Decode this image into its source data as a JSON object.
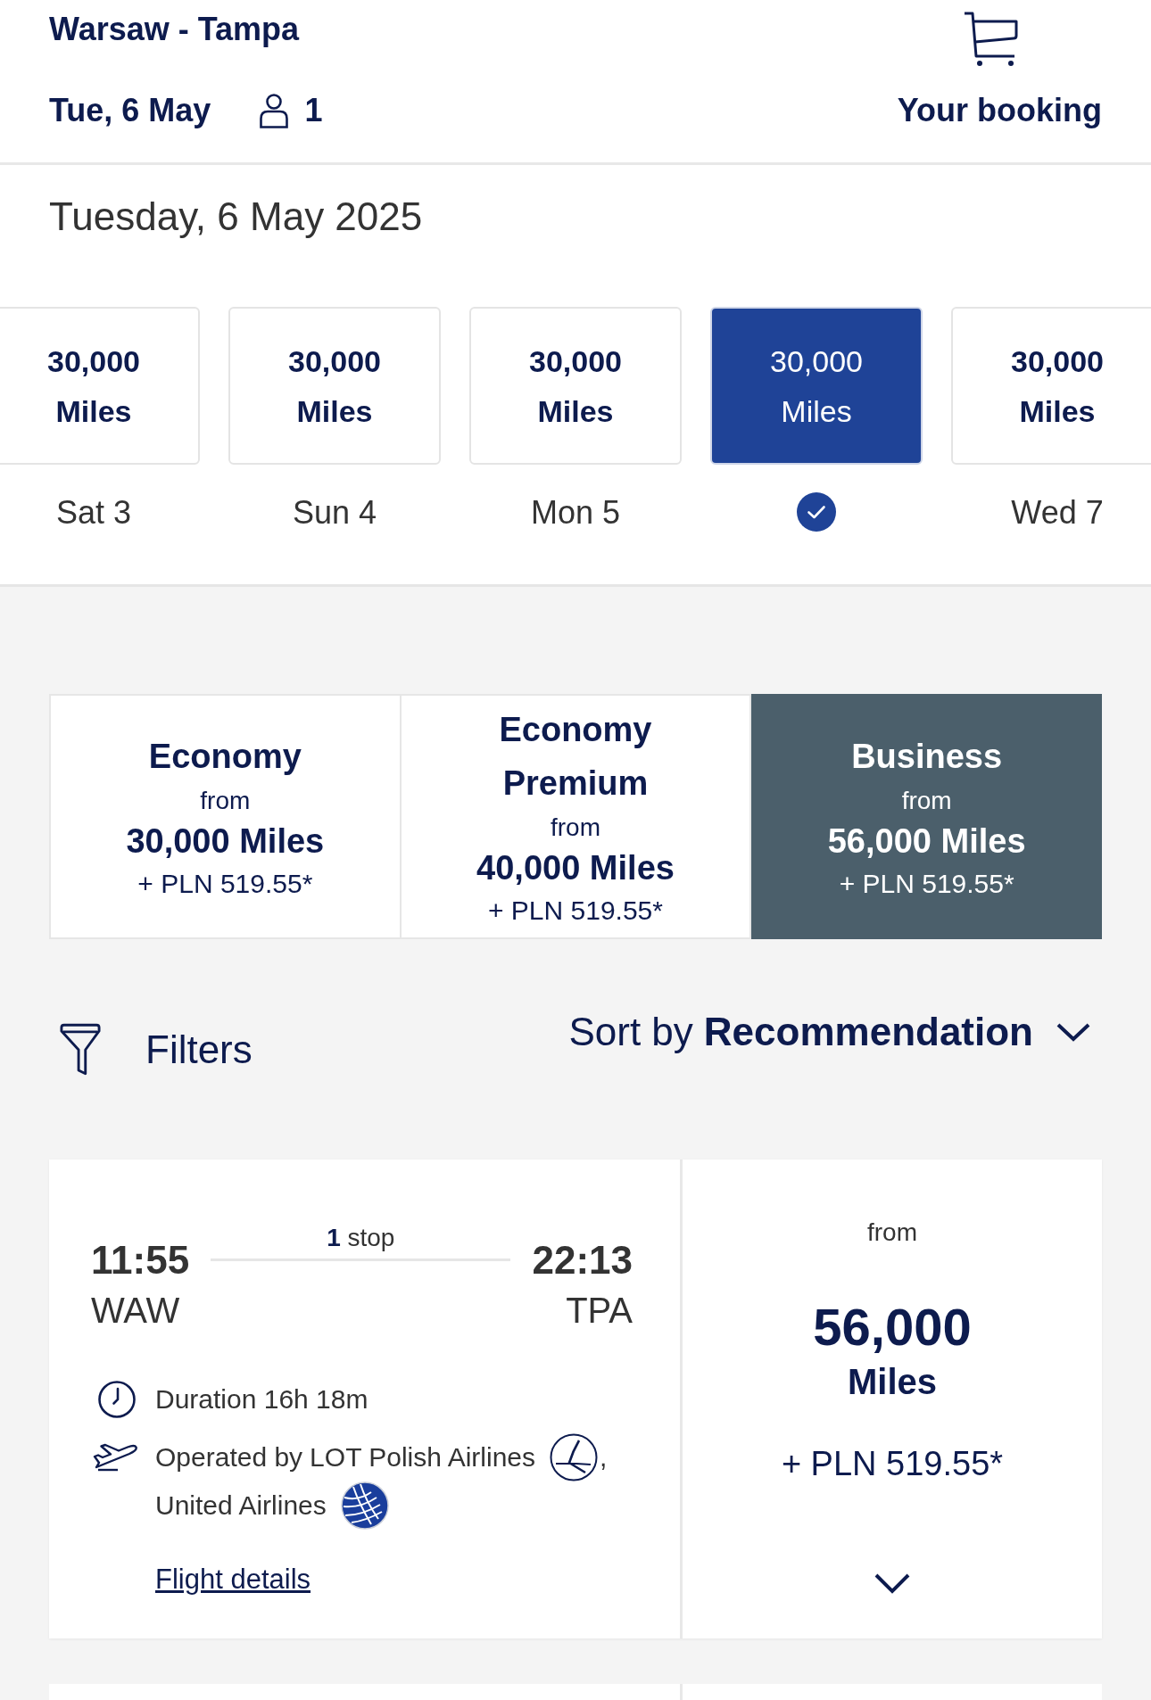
{
  "header": {
    "route": "Warsaw - Tampa",
    "date": "Tue, 6 May",
    "passengers": "1",
    "booking_label": "Your booking"
  },
  "date_bar": {
    "title": "Tuesday, 6 May 2025",
    "dates": [
      {
        "miles": "30,000",
        "unit": "Miles",
        "day": "Sat 3",
        "selected": false
      },
      {
        "miles": "30,000",
        "unit": "Miles",
        "day": "Sun 4",
        "selected": false
      },
      {
        "miles": "30,000",
        "unit": "Miles",
        "day": "Mon 5",
        "selected": false
      },
      {
        "miles": "30,000",
        "unit": "Miles",
        "selected": true
      },
      {
        "miles": "30,000",
        "unit": "Miles",
        "day": "Wed 7",
        "selected": false
      }
    ]
  },
  "cabins": [
    {
      "name": "Economy",
      "from": "from",
      "miles": "30,000 Miles",
      "price": "+ PLN 519.55*",
      "selected": false
    },
    {
      "name": "Economy Premium",
      "from": "from",
      "miles": "40,000 Miles",
      "price": "+ PLN 519.55*",
      "selected": false
    },
    {
      "name": "Business",
      "from": "from",
      "miles": "56,000 Miles",
      "price": "+ PLN 519.55*",
      "selected": true
    }
  ],
  "toolbar": {
    "filters": "Filters",
    "sort_label": "Sort by",
    "sort_value": "Recommendation"
  },
  "flights": [
    {
      "departure": {
        "time": "11:55",
        "airport": "WAW"
      },
      "stops": "**1** stop",
      "arrival": {
        "time": "22:13",
        "airport": "TPA"
      },
      "duration": "Duration 16h 18m",
      "operated_by": "Operated by",
      "separator": ",",
      "carriers": [
        {
          "name": "LOT Polish Airlines",
          "kind": "crane"
        },
        {
          "name": "United Airlines",
          "kind": "globe"
        }
      ],
      "details_link": "Flight details",
      "price": {
        "from": "from",
        "miles": "56,000",
        "unit": "Miles",
        "fee": "+ PLN 519.55*"
      },
      "expanded": false
    }
  ]
}
